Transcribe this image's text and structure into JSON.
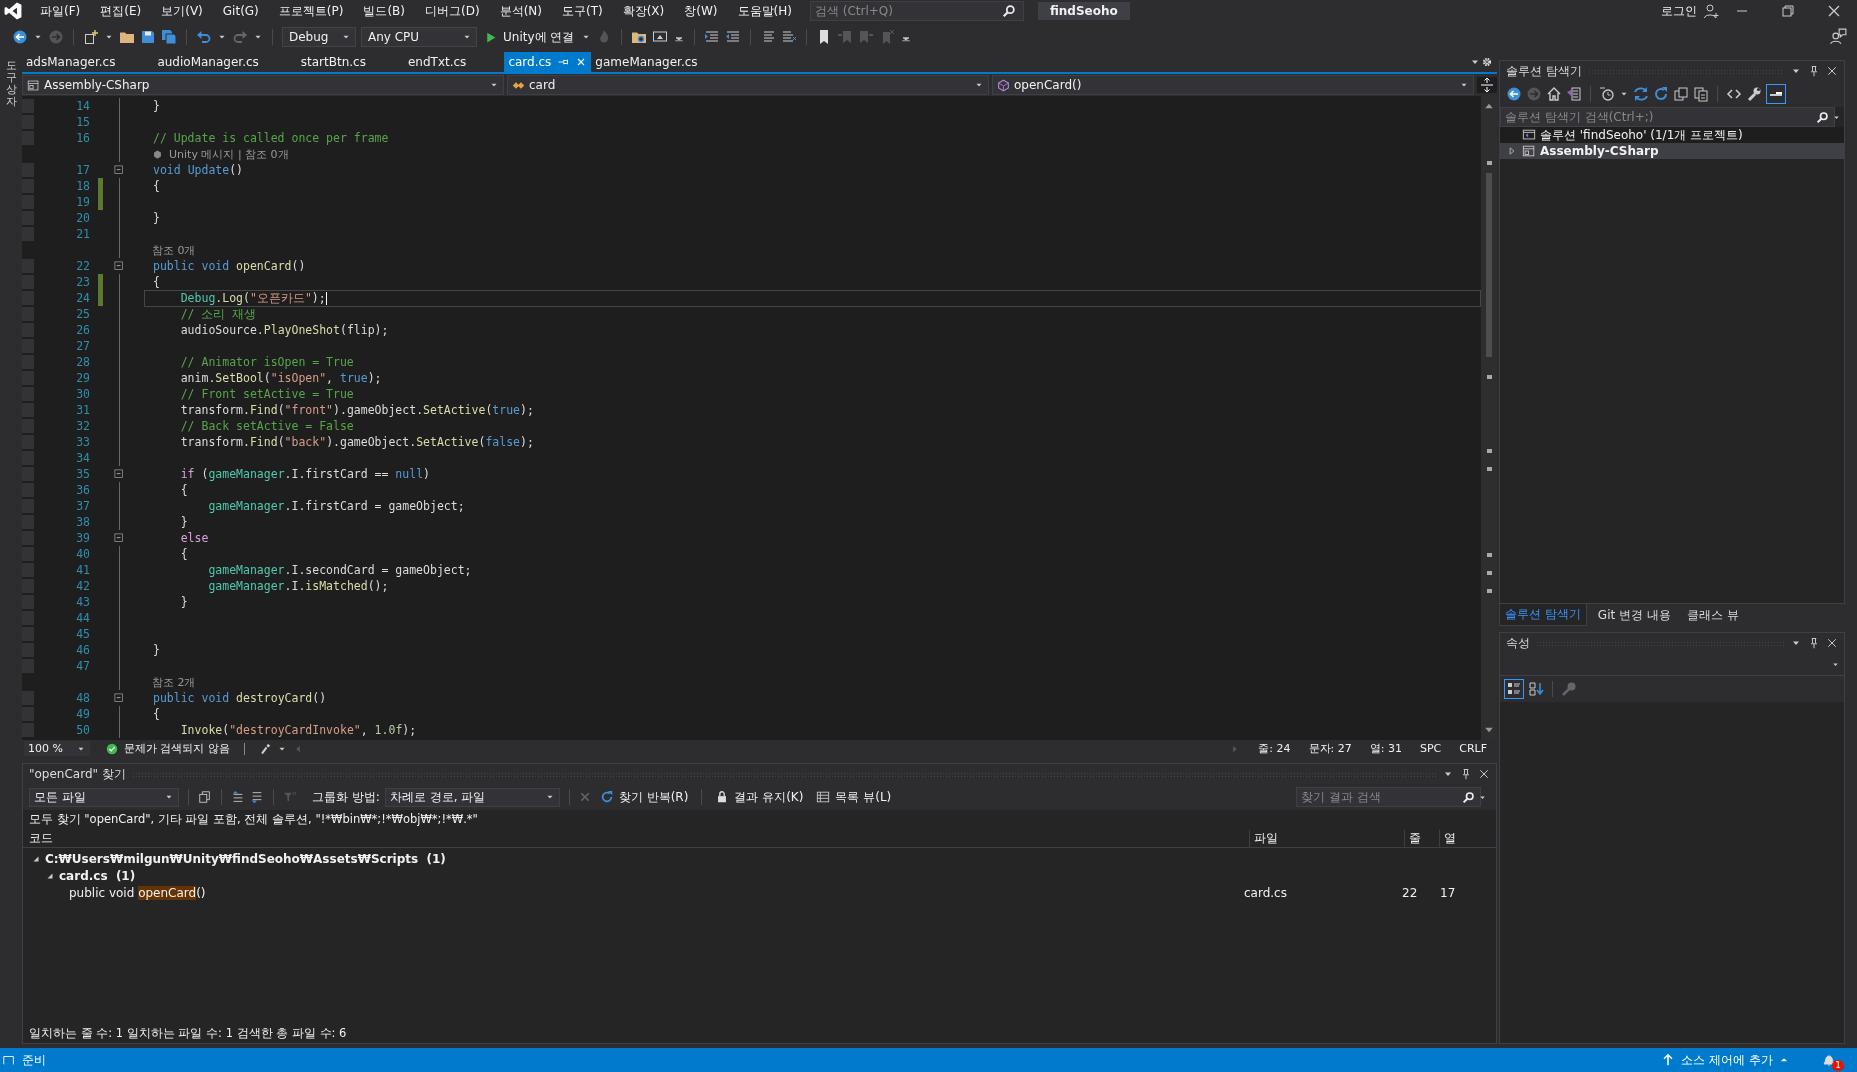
{
  "menu": {
    "items": [
      "파일(F)",
      "편집(E)",
      "보기(V)",
      "Git(G)",
      "프로젝트(P)",
      "빌드(B)",
      "디버그(D)",
      "분석(N)",
      "도구(T)",
      "확장(X)",
      "창(W)",
      "도움말(H)"
    ],
    "search_placeholder": "검색 (Ctrl+Q)",
    "solution_title": "findSeoho",
    "login": "로그인"
  },
  "toolbar": {
    "configuration": "Debug",
    "platform": "Any CPU",
    "run_label": "Unity에 연결"
  },
  "toolbox_label": "도구 상자",
  "tabs": [
    {
      "label": "adsManager.cs",
      "selected": false
    },
    {
      "label": "audioManager.cs",
      "selected": false
    },
    {
      "label": "startBtn.cs",
      "selected": false
    },
    {
      "label": "endTxt.cs",
      "selected": false
    },
    {
      "label": "card.cs",
      "selected": true
    },
    {
      "label": "gameManager.cs",
      "selected": false
    }
  ],
  "navbar": {
    "project": "Assembly-CSharp",
    "type": "card",
    "member": "openCard()"
  },
  "code": {
    "lines": [
      {
        "kind": "code",
        "num": "14",
        "changed": false,
        "fold": false,
        "current": false,
        "tokens": [
          {
            "kind": "plain",
            "text": "}"
          }
        ]
      },
      {
        "kind": "code",
        "num": "15",
        "changed": false,
        "fold": false,
        "current": false
      },
      {
        "kind": "code",
        "num": "16",
        "changed": false,
        "fold": false,
        "current": false,
        "tokens": [
          {
            "kind": "comment",
            "text": "// Update is called once per frame"
          }
        ]
      },
      {
        "kind": "lens",
        "text": "Unity 메시지 | 참조 0개",
        "unity": true
      },
      {
        "kind": "code",
        "num": "17",
        "changed": false,
        "fold": true,
        "current": false,
        "tokens": [
          {
            "kind": "kw",
            "text": "void "
          },
          {
            "kind": "kw",
            "text": "Update"
          },
          {
            "kind": "plain",
            "text": "()"
          }
        ]
      },
      {
        "kind": "code",
        "num": "18",
        "changed": true,
        "fold": false,
        "current": false,
        "tokens": [
          {
            "kind": "plain",
            "text": "{"
          }
        ]
      },
      {
        "kind": "code",
        "num": "19",
        "changed": true,
        "fold": false,
        "current": false
      },
      {
        "kind": "code",
        "num": "20",
        "changed": false,
        "fold": false,
        "current": false,
        "tokens": [
          {
            "kind": "plain",
            "text": "}"
          }
        ]
      },
      {
        "kind": "code",
        "num": "21",
        "changed": false,
        "fold": false,
        "current": false
      },
      {
        "kind": "lens",
        "text": "참조 0개",
        "unity": false
      },
      {
        "kind": "code",
        "num": "22",
        "changed": false,
        "fold": true,
        "current": false,
        "tokens": [
          {
            "kind": "kw",
            "text": "public void "
          },
          {
            "kind": "method",
            "text": "openCard"
          },
          {
            "kind": "plain",
            "text": "()"
          }
        ]
      },
      {
        "kind": "code",
        "num": "23",
        "changed": true,
        "fold": false,
        "current": false,
        "tokens": [
          {
            "kind": "plain",
            "text": "{"
          }
        ]
      },
      {
        "kind": "code",
        "num": "24",
        "changed": true,
        "fold": false,
        "current": true,
        "tokens": [
          {
            "kind": "type",
            "text": "    Debug"
          },
          {
            "kind": "method",
            "text": ".Log"
          },
          {
            "kind": "plain",
            "text": "("
          },
          {
            "kind": "str",
            "text": "\"오픈카드\""
          },
          {
            "kind": "plain",
            "text": ");"
          }
        ]
      },
      {
        "kind": "code",
        "num": "25",
        "changed": false,
        "fold": false,
        "current": false,
        "tokens": [
          {
            "kind": "comment",
            "text": "    // 소리 재생"
          }
        ]
      },
      {
        "kind": "code",
        "num": "26",
        "changed": false,
        "fold": false,
        "current": false,
        "tokens": [
          {
            "kind": "plain",
            "text": "    audioSource."
          },
          {
            "kind": "method",
            "text": "PlayOneShot"
          },
          {
            "kind": "plain",
            "text": "(flip);"
          }
        ]
      },
      {
        "kind": "code",
        "num": "27",
        "changed": false,
        "fold": false,
        "current": false
      },
      {
        "kind": "code",
        "num": "28",
        "changed": false,
        "fold": false,
        "current": false,
        "tokens": [
          {
            "kind": "comment",
            "text": "    // Animator isOpen = True"
          }
        ]
      },
      {
        "kind": "code",
        "num": "29",
        "changed": false,
        "fold": false,
        "current": false,
        "tokens": [
          {
            "kind": "plain",
            "text": "    anim."
          },
          {
            "kind": "method",
            "text": "SetBool"
          },
          {
            "kind": "plain",
            "text": "("
          },
          {
            "kind": "str",
            "text": "\"isOpen\""
          },
          {
            "kind": "plain",
            "text": ", "
          },
          {
            "kind": "kw",
            "text": "true"
          },
          {
            "kind": "plain",
            "text": ");"
          }
        ]
      },
      {
        "kind": "code",
        "num": "30",
        "changed": false,
        "fold": false,
        "current": false,
        "tokens": [
          {
            "kind": "comment",
            "text": "    // Front setActive = True"
          }
        ]
      },
      {
        "kind": "code",
        "num": "31",
        "changed": false,
        "fold": false,
        "current": false,
        "tokens": [
          {
            "kind": "plain",
            "text": "    transform."
          },
          {
            "kind": "method",
            "text": "Find"
          },
          {
            "kind": "plain",
            "text": "("
          },
          {
            "kind": "str",
            "text": "\"front\""
          },
          {
            "kind": "plain",
            "text": ").gameObject."
          },
          {
            "kind": "method",
            "text": "SetActive"
          },
          {
            "kind": "plain",
            "text": "("
          },
          {
            "kind": "kw",
            "text": "true"
          },
          {
            "kind": "plain",
            "text": ");"
          }
        ]
      },
      {
        "kind": "code",
        "num": "32",
        "changed": false,
        "fold": false,
        "current": false,
        "tokens": [
          {
            "kind": "comment",
            "text": "    // Back setActive = False"
          }
        ]
      },
      {
        "kind": "code",
        "num": "33",
        "changed": false,
        "fold": false,
        "current": false,
        "tokens": [
          {
            "kind": "plain",
            "text": "    transform."
          },
          {
            "kind": "method",
            "text": "Find"
          },
          {
            "kind": "plain",
            "text": "("
          },
          {
            "kind": "str",
            "text": "\"back\""
          },
          {
            "kind": "plain",
            "text": ").gameObject."
          },
          {
            "kind": "method",
            "text": "SetActive"
          },
          {
            "kind": "plain",
            "text": "("
          },
          {
            "kind": "kw",
            "text": "false"
          },
          {
            "kind": "plain",
            "text": ");"
          }
        ]
      },
      {
        "kind": "code",
        "num": "34",
        "changed": false,
        "fold": false,
        "current": false
      },
      {
        "kind": "code",
        "num": "35",
        "changed": false,
        "fold": true,
        "current": false,
        "tokens": [
          {
            "kind": "ctrl",
            "text": "    if"
          },
          {
            "kind": "plain",
            "text": " ("
          },
          {
            "kind": "type",
            "text": "gameManager"
          },
          {
            "kind": "plain",
            "text": ".I.firstCard == "
          },
          {
            "kind": "kw",
            "text": "null"
          },
          {
            "kind": "plain",
            "text": ")"
          }
        ]
      },
      {
        "kind": "code",
        "num": "36",
        "changed": false,
        "fold": false,
        "current": false,
        "tokens": [
          {
            "kind": "plain",
            "text": "    {"
          }
        ]
      },
      {
        "kind": "code",
        "num": "37",
        "changed": false,
        "fold": false,
        "current": false,
        "tokens": [
          {
            "kind": "type",
            "text": "        gameManager"
          },
          {
            "kind": "plain",
            "text": ".I.firstCard = gameObject;"
          }
        ]
      },
      {
        "kind": "code",
        "num": "38",
        "changed": false,
        "fold": false,
        "current": false,
        "tokens": [
          {
            "kind": "plain",
            "text": "    }"
          }
        ]
      },
      {
        "kind": "code",
        "num": "39",
        "changed": false,
        "fold": true,
        "current": false,
        "tokens": [
          {
            "kind": "ctrl",
            "text": "    else"
          }
        ]
      },
      {
        "kind": "code",
        "num": "40",
        "changed": false,
        "fold": false,
        "current": false,
        "tokens": [
          {
            "kind": "plain",
            "text": "    {"
          }
        ]
      },
      {
        "kind": "code",
        "num": "41",
        "changed": false,
        "fold": false,
        "current": false,
        "tokens": [
          {
            "kind": "type",
            "text": "        gameManager"
          },
          {
            "kind": "plain",
            "text": ".I.secondCard = gameObject;"
          }
        ]
      },
      {
        "kind": "code",
        "num": "42",
        "changed": false,
        "fold": false,
        "current": false,
        "tokens": [
          {
            "kind": "type",
            "text": "        gameManager"
          },
          {
            "kind": "plain",
            "text": ".I."
          },
          {
            "kind": "method",
            "text": "isMatched"
          },
          {
            "kind": "plain",
            "text": "();"
          }
        ]
      },
      {
        "kind": "code",
        "num": "43",
        "changed": false,
        "fold": false,
        "current": false,
        "tokens": [
          {
            "kind": "plain",
            "text": "    }"
          }
        ]
      },
      {
        "kind": "code",
        "num": "44",
        "changed": false,
        "fold": false,
        "current": false
      },
      {
        "kind": "code",
        "num": "45",
        "changed": false,
        "fold": false,
        "current": false
      },
      {
        "kind": "code",
        "num": "46",
        "changed": false,
        "fold": false,
        "current": false,
        "tokens": [
          {
            "kind": "plain",
            "text": "}"
          }
        ]
      },
      {
        "kind": "code",
        "num": "47",
        "changed": false,
        "fold": false,
        "current": false
      },
      {
        "kind": "lens",
        "text": "참조 2개",
        "unity": false
      },
      {
        "kind": "code",
        "num": "48",
        "changed": false,
        "fold": true,
        "current": false,
        "tokens": [
          {
            "kind": "kw",
            "text": "public void "
          },
          {
            "kind": "method",
            "text": "destroyCard"
          },
          {
            "kind": "plain",
            "text": "()"
          }
        ]
      },
      {
        "kind": "code",
        "num": "49",
        "changed": false,
        "fold": false,
        "current": false,
        "tokens": [
          {
            "kind": "plain",
            "text": "{"
          }
        ]
      },
      {
        "kind": "code",
        "num": "50",
        "changed": false,
        "fold": false,
        "current": false,
        "tokens": [
          {
            "kind": "method",
            "text": "    Invoke"
          },
          {
            "kind": "plain",
            "text": "("
          },
          {
            "kind": "str",
            "text": "\"destroyCardInvoke\""
          },
          {
            "kind": "plain",
            "text": ", "
          },
          {
            "kind": "num",
            "text": "1.0f"
          },
          {
            "kind": "plain",
            "text": ");"
          }
        ]
      }
    ]
  },
  "editor_status": {
    "zoom": "100 %",
    "issues": "문제가 검색되지 않음",
    "line": "줄: 24",
    "char": "문자: 27",
    "col": "열: 31",
    "whitespace": "SPC",
    "eol": "CRLF"
  },
  "find_panel": {
    "title": "\"openCard\" 찾기",
    "scope": "모든 파일",
    "group_label": "그룹화 방법:",
    "group_value": "차례로 경로, 파일",
    "repeat_button": "찾기 반복(R)",
    "keep_button": "결과 유지(K)",
    "list_view_button": "목록 뷰(L)",
    "search_placeholder": "찾기 결과 검색",
    "summary": "모두 찾기 \"openCard\", 기타 파일 포함, 전체 솔루션, \"!*₩bin₩*;!*₩obj₩*;!*₩.*\"",
    "columns": [
      "코드",
      "파일",
      "줄",
      "열"
    ],
    "results": [
      {
        "label": "C:₩Users₩milgun₩Unity₩findSeoho₩Assets₩Scripts  (1)",
        "expanded": true,
        "children": [
          {
            "label": "card.cs  (1)",
            "expanded": true,
            "children": [
              {
                "code_before": "public void ",
                "match": "openCard",
                "code_after": "()",
                "file": "card.cs",
                "line": "22",
                "column": "17"
              }
            ]
          }
        ]
      }
    ],
    "footer": "일치하는 줄 수: 1 일치하는 파일 수: 1 검색한 총 파일 수: 6"
  },
  "solution_explorer": {
    "title": "솔루션 탐색기",
    "search_placeholder": "솔루션 탐색기 검색(Ctrl+;)",
    "tree": [
      {
        "label": "솔루션 'findSeoho' (1/1개 프로젝트)",
        "children": [
          {
            "label": "Assembly-CSharp",
            "expanded": false,
            "selected": true
          }
        ]
      }
    ]
  },
  "panel_tabs": [
    {
      "label": "솔루션 탐색기",
      "selected": true
    },
    {
      "label": "Git 변경 내용",
      "selected": false
    },
    {
      "label": "클래스 뷰",
      "selected": false
    }
  ],
  "properties": {
    "title": "속성"
  },
  "status_bar": {
    "text": "준비",
    "source_control": "소스 제어에 추가",
    "notifications": "1"
  }
}
